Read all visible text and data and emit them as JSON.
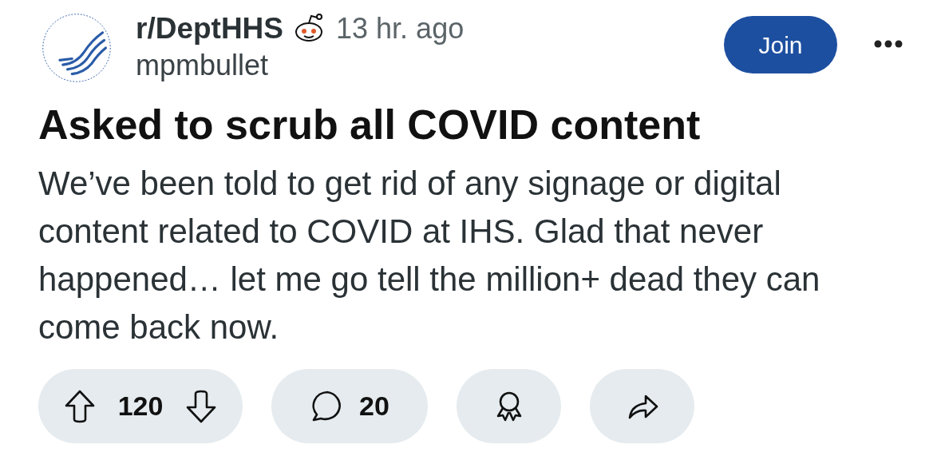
{
  "community": {
    "name": "r/DeptHHS",
    "time": "13 hr. ago",
    "author": "mpmbullet"
  },
  "join_button": {
    "label": "Join"
  },
  "post": {
    "title": "Asked to scrub all COVID content",
    "body": "We’ve been told to get rid of any signage or digital content related to COVID at IHS. Glad that never happened… let me go tell the million+ dead they can come back now."
  },
  "actions": [
    {
      "kind": "vote",
      "count": "120"
    },
    {
      "kind": "comments",
      "count": "20"
    },
    {
      "kind": "award"
    },
    {
      "kind": "share"
    }
  ]
}
